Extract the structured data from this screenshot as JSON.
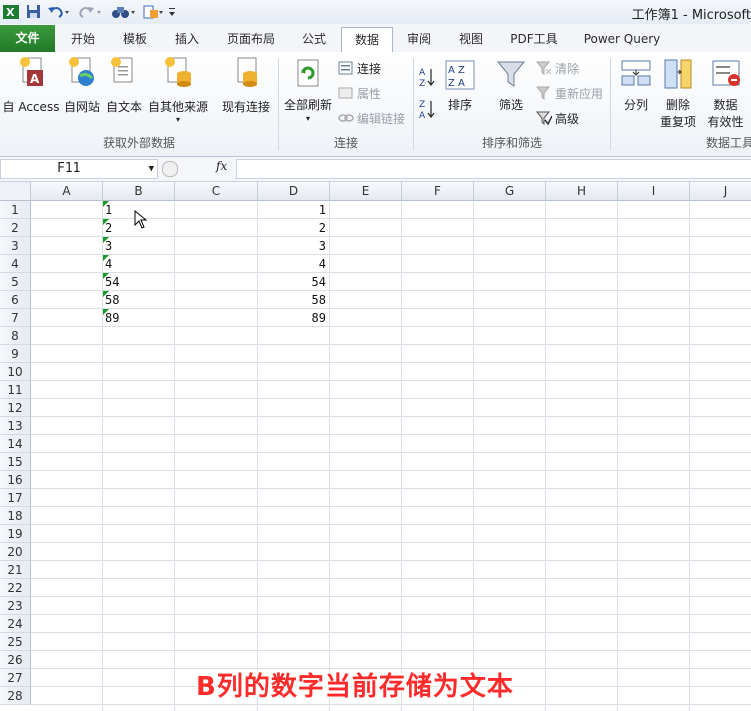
{
  "window": {
    "title": "工作簿1 - Microsoft"
  },
  "quick_access": {
    "app_icon": "excel-icon",
    "icons": [
      "save-icon",
      "undo-icon",
      "redo-icon",
      "binoculars-icon",
      "format-painter-icon",
      "customize-toolbar-icon"
    ]
  },
  "tabs": [
    {
      "label": "文件"
    },
    {
      "label": "开始"
    },
    {
      "label": "模板"
    },
    {
      "label": "插入"
    },
    {
      "label": "页面布局"
    },
    {
      "label": "公式"
    },
    {
      "label": "数据"
    },
    {
      "label": "审阅"
    },
    {
      "label": "视图"
    },
    {
      "label": "PDF工具"
    },
    {
      "label": "Power Query"
    }
  ],
  "active_tab": "数据",
  "ribbon": {
    "get_external": {
      "group_label": "获取外部数据",
      "from_access": "自 Access",
      "from_web": "自网站",
      "from_text": "自文本",
      "from_other": "自其他来源",
      "existing_connections": "现有连接"
    },
    "connections": {
      "group_label": "连接",
      "refresh_all": "全部刷新",
      "connections": "连接",
      "properties": "属性",
      "edit_links": "编辑链接"
    },
    "sort_filter": {
      "group_label": "排序和筛选",
      "sort": "排序",
      "filter": "筛选",
      "clear": "清除",
      "reapply": "重新应用",
      "advanced": "高级"
    },
    "data_tools": {
      "group_label": "数据工具",
      "text_to_columns": "分列",
      "remove_duplicates_1": "删除",
      "remove_duplicates_2": "重复项",
      "data_validation_1": "数据",
      "data_validation_2": "有效性"
    }
  },
  "formula_bar": {
    "name_box": "F11",
    "fx": "fx",
    "formula": ""
  },
  "sheet": {
    "columns": [
      "A",
      "B",
      "C",
      "D",
      "E",
      "F",
      "G",
      "H",
      "I",
      "J"
    ],
    "rows": [
      "1",
      "2",
      "3",
      "4",
      "5",
      "6",
      "7",
      "8",
      "9",
      "10",
      "11",
      "12",
      "13",
      "14",
      "15",
      "16",
      "17",
      "18",
      "19",
      "20",
      "21",
      "22",
      "23",
      "24",
      "25",
      "26",
      "27",
      "28"
    ],
    "col_b_text": [
      "1",
      "2",
      "3",
      "4",
      "54",
      "58",
      "89"
    ],
    "col_d_numbers": [
      "1",
      "2",
      "3",
      "4",
      "54",
      "58",
      "89"
    ],
    "text_number_indicator_color": "#1a9a2a"
  },
  "caption": "B列的数字当前存储为文本",
  "colors": {
    "file_tab": "#2a8a30",
    "caption": "#ff2b2b",
    "accent": "#1f7a28"
  }
}
